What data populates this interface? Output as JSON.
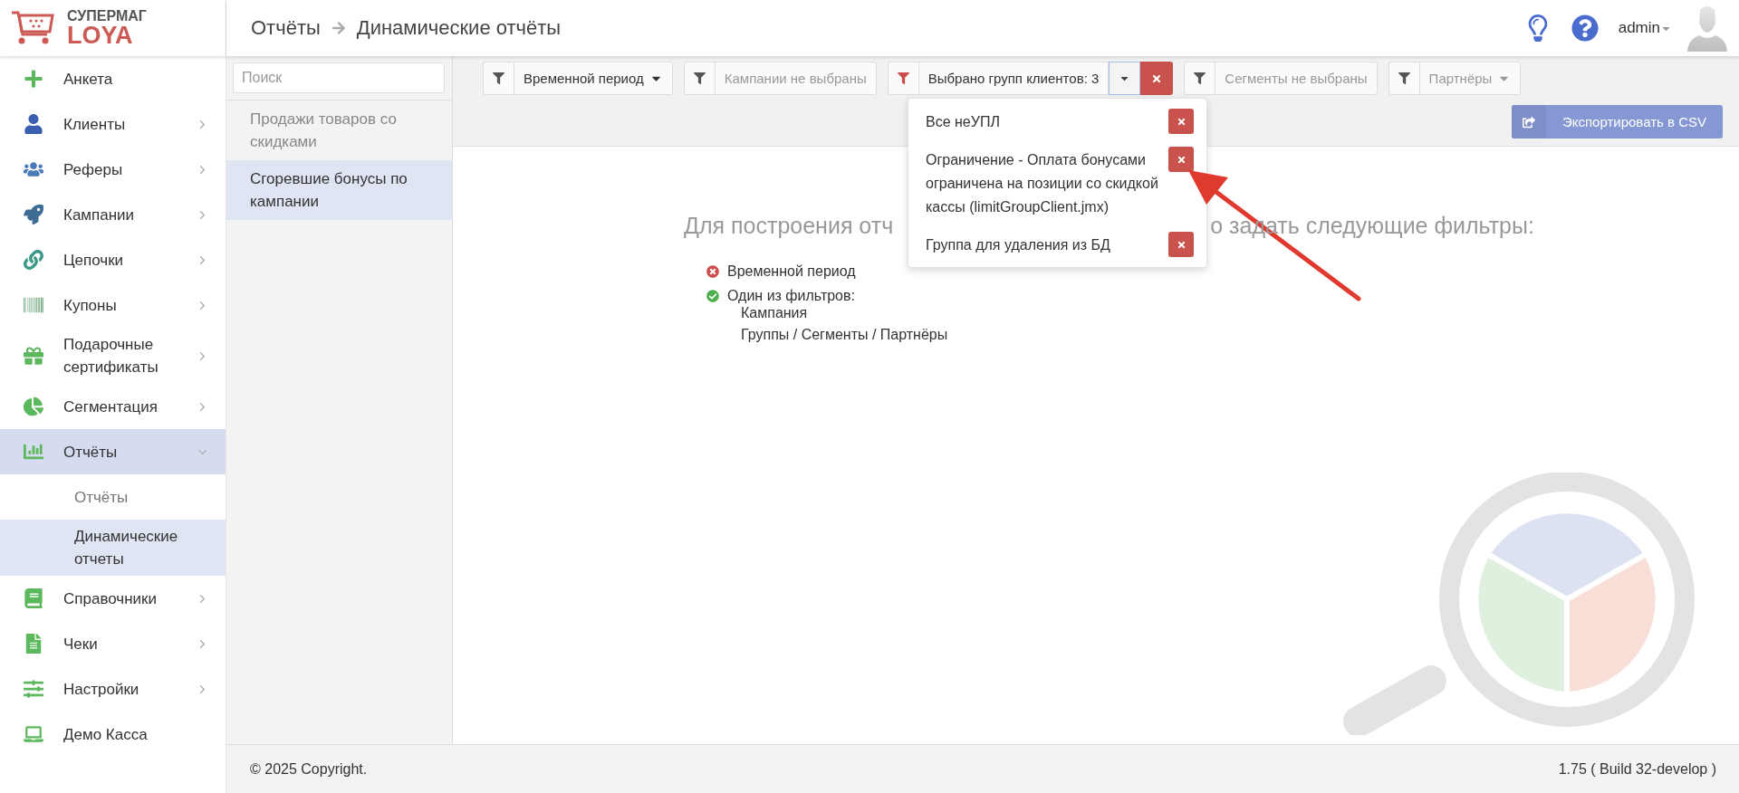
{
  "logo": {
    "line1": "СУПЕРМАГ",
    "line2": "LOYA"
  },
  "breadcrumb": [
    "Отчёты",
    "Динамические отчёты"
  ],
  "user": {
    "name": "admin"
  },
  "sidebar": {
    "items": [
      {
        "label": "Анкета",
        "kind": "link",
        "selected": false
      },
      {
        "label": "Клиенты",
        "kind": "group",
        "expanded": false,
        "selected": false
      },
      {
        "label": "Реферы",
        "kind": "group",
        "expanded": false,
        "selected": false
      },
      {
        "label": "Кампании",
        "kind": "group",
        "expanded": false,
        "selected": false
      },
      {
        "label": "Цепочки",
        "kind": "group",
        "expanded": false,
        "selected": false
      },
      {
        "label": "Купоны",
        "kind": "group",
        "expanded": false,
        "selected": false
      },
      {
        "label": "Подарочные сертификаты",
        "kind": "group",
        "expanded": false,
        "selected": false
      },
      {
        "label": "Сегментация",
        "kind": "group",
        "expanded": false,
        "selected": false
      },
      {
        "label": "Отчёты",
        "kind": "group",
        "expanded": true,
        "selected": true,
        "children": [
          {
            "label": "Отчёты",
            "selected": false
          },
          {
            "label": "Динамические отчеты",
            "selected": true
          }
        ]
      },
      {
        "label": "Справочники",
        "kind": "group",
        "expanded": false,
        "selected": false
      },
      {
        "label": "Чеки",
        "kind": "group",
        "expanded": false,
        "selected": false
      },
      {
        "label": "Настройки",
        "kind": "group",
        "expanded": false,
        "selected": false
      },
      {
        "label": "Демо Касса",
        "kind": "link",
        "selected": false
      }
    ]
  },
  "reports": {
    "search": {
      "placeholder": "Поиск"
    },
    "items": [
      {
        "label": "Продажи товаров со скидками",
        "selected": false
      },
      {
        "label": "Сгоревшие бонусы по кампании",
        "selected": true
      }
    ]
  },
  "filters": [
    {
      "label": "Временной период",
      "kind": "menu",
      "muted": false
    },
    {
      "label": "Кампании не выбраны",
      "kind": "plain",
      "muted": true
    },
    {
      "label": "Выбрано групп клиентов: 3",
      "kind": "selection",
      "muted": false
    },
    {
      "label": "Сегменты не выбраны",
      "kind": "plain",
      "muted": true
    },
    {
      "label": "Партнёры",
      "kind": "menu",
      "muted": true
    }
  ],
  "export_button": {
    "label": "Экспортировать в CSV"
  },
  "group_dropdown": {
    "items": [
      {
        "label": "Все неУПЛ"
      },
      {
        "label": "Ограничение - Оплата бонусами ограничена на позиции со скидкой кассы (limitGroupClient.jmx)"
      },
      {
        "label": "Группа для удаления из БД"
      }
    ]
  },
  "requirements": {
    "heading_parts": [
      "Для построения отч",
      "о задать следующие фильтры:"
    ],
    "items": [
      {
        "label": "Временной период",
        "met": false
      },
      {
        "label": "Один из фильтров:",
        "met": true,
        "children": [
          "Кампания",
          "Группы / Сегменты / Партнёры"
        ]
      }
    ]
  },
  "footer": {
    "copyright": "© 2025 Copyright.",
    "version": "1.75 ( Build 32-develop )"
  }
}
